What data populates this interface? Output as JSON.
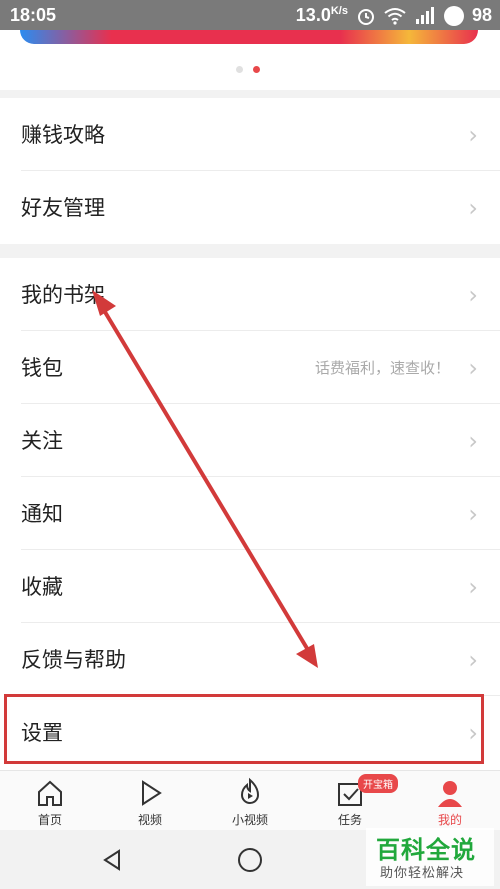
{
  "status": {
    "time": "18:05",
    "speed": "13.0",
    "speed_unit": "K/s",
    "battery": "98"
  },
  "menu": {
    "group1": [
      {
        "label": "赚钱攻略"
      },
      {
        "label": "好友管理"
      }
    ],
    "group2": [
      {
        "label": "我的书架"
      },
      {
        "label": "钱包",
        "sub": "话费福利，速查收！"
      },
      {
        "label": "关注"
      },
      {
        "label": "通知"
      },
      {
        "label": "收藏"
      },
      {
        "label": "反馈与帮助"
      },
      {
        "label": "设置"
      }
    ]
  },
  "tabs": [
    {
      "label": "首页",
      "icon": "home-icon"
    },
    {
      "label": "视频",
      "icon": "play-icon"
    },
    {
      "label": "小视频",
      "icon": "small-video-icon"
    },
    {
      "label": "任务",
      "icon": "task-icon",
      "badge": "开宝箱"
    },
    {
      "label": "我的",
      "icon": "person-icon"
    }
  ],
  "watermark": {
    "title": "百科全说",
    "subtitle": "助你轻松解决"
  },
  "colors": {
    "accent": "#e8484a",
    "arrow": "#d23a3a",
    "watermark_green": "#21a83c"
  }
}
